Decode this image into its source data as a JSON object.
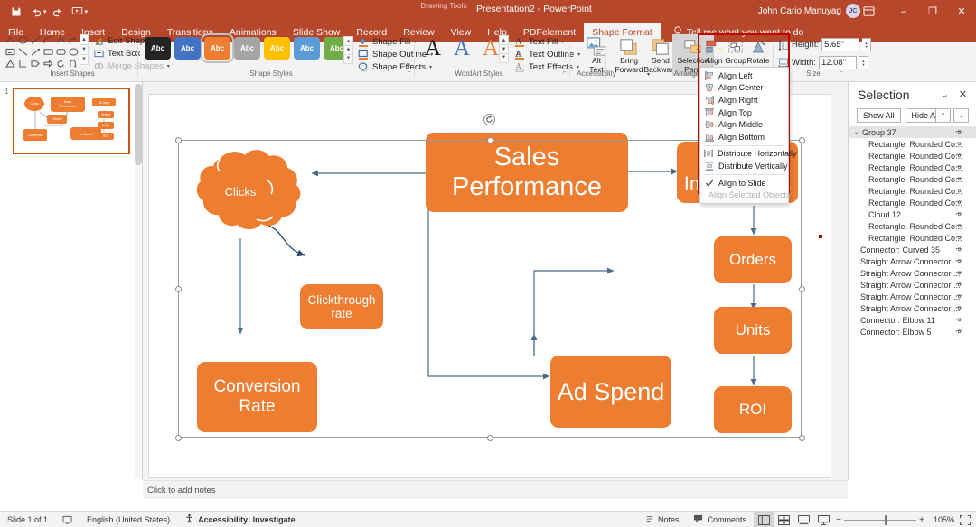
{
  "titlebar": {
    "quick_access": [
      "save-icon",
      "undo-icon",
      "redo-icon",
      "start-presentation-icon",
      "customize-qat-icon"
    ],
    "contextual_tab_group": "Drawing Tools",
    "window_title": "Presentation2  -  PowerPoint",
    "user_name": "John Cario Manuyag",
    "avatar_initials": "JC",
    "ribbon_display_options": "ribbon-display-options-icon",
    "minimize": "–",
    "restore": "❐",
    "close": "✕"
  },
  "tabs": [
    {
      "label": "File",
      "active": false
    },
    {
      "label": "Home",
      "active": false
    },
    {
      "label": "Insert",
      "active": false
    },
    {
      "label": "Design",
      "active": false
    },
    {
      "label": "Transitions",
      "active": false
    },
    {
      "label": "Animations",
      "active": false
    },
    {
      "label": "Slide Show",
      "active": false
    },
    {
      "label": "Record",
      "active": false
    },
    {
      "label": "Review",
      "active": false
    },
    {
      "label": "View",
      "active": false
    },
    {
      "label": "Help",
      "active": false
    },
    {
      "label": "PDFelement",
      "active": false
    },
    {
      "label": "Shape Format",
      "active": true
    }
  ],
  "tell_me": "Tell me what you want to do",
  "ribbon": {
    "groups": [
      {
        "name": "Insert Shapes",
        "label": "Insert Shapes"
      },
      {
        "name": "Shape Styles",
        "label": "Shape Styles"
      },
      {
        "name": "WordArt Styles",
        "label": "WordArt Styles"
      },
      {
        "name": "Accessibility",
        "label": "Accessibility"
      },
      {
        "name": "Arrange",
        "label": "Arrange"
      },
      {
        "name": "Size",
        "label": "Size"
      }
    ],
    "insert_shapes": {
      "commands": [
        {
          "label": "Edit Shape",
          "icon": "edit-shape-icon",
          "has_caret": true,
          "disabled": false
        },
        {
          "label": "Text Box",
          "icon": "text-box-icon",
          "has_caret": false,
          "disabled": false
        },
        {
          "label": "Merge Shapes",
          "icon": "merge-shapes-icon",
          "has_caret": true,
          "disabled": true
        }
      ]
    },
    "shape_styles": {
      "swatch_label": "Abc",
      "swatches": [
        {
          "fill": "#242424",
          "selected": false
        },
        {
          "fill": "#4472c4",
          "selected": false
        },
        {
          "fill": "#ed7d31",
          "selected": true
        },
        {
          "fill": "#a5a5a5",
          "selected": false
        },
        {
          "fill": "#ffc000",
          "selected": false
        },
        {
          "fill": "#5b9bd5",
          "selected": false
        },
        {
          "fill": "#70ad47",
          "selected": false
        }
      ],
      "commands": [
        {
          "label": "Shape Fill",
          "icon": "shape-fill-icon"
        },
        {
          "label": "Shape Outline",
          "icon": "shape-outline-icon"
        },
        {
          "label": "Shape Effects",
          "icon": "shape-effects-icon"
        }
      ]
    },
    "wordart_styles": {
      "letters": [
        "A",
        "A",
        "A"
      ],
      "commands": [
        {
          "label": "Text Fill",
          "icon": "text-fill-icon"
        },
        {
          "label": "Text Outline",
          "icon": "text-outline-icon"
        },
        {
          "label": "Text Effects",
          "icon": "text-effects-icon"
        }
      ]
    },
    "accessibility": {
      "alt_text": "Alt\nText",
      "alt_text_line1": "Alt",
      "alt_text_line2": "Text"
    },
    "arrange": {
      "bring_forward_l1": "Bring",
      "bring_forward_l2": "Forward",
      "send_backward_l1": "Send",
      "send_backward_l2": "Backward",
      "selection_pane_l1": "Selection",
      "selection_pane_l2": "Pane",
      "align": "Align",
      "group": "Group",
      "rotate": "Rotate"
    },
    "size": {
      "height_label": "Height:",
      "height_value": "5.65\"",
      "width_label": "Width:",
      "width_value": "12.08\""
    }
  },
  "align_menu": {
    "items": [
      {
        "label": "Align Left",
        "icon": "align-left-icon",
        "checked": false,
        "disabled": false
      },
      {
        "label": "Align Center",
        "icon": "align-center-icon",
        "checked": false,
        "disabled": false
      },
      {
        "label": "Align Right",
        "icon": "align-right-icon",
        "checked": false,
        "disabled": false
      },
      {
        "label": "Align Top",
        "icon": "align-top-icon",
        "checked": false,
        "disabled": false
      },
      {
        "label": "Align Middle",
        "icon": "align-middle-icon",
        "checked": false,
        "disabled": false
      },
      {
        "label": "Align Bottom",
        "icon": "align-bottom-icon",
        "checked": false,
        "disabled": false
      },
      {
        "label": "Distribute Horizontally",
        "icon": "distribute-horizontally-icon",
        "checked": false,
        "disabled": false
      },
      {
        "label": "Distribute Vertically",
        "icon": "distribute-vertically-icon",
        "checked": false,
        "disabled": false
      },
      {
        "label": "Align to Slide",
        "icon": "checkmark-icon",
        "checked": true,
        "disabled": false
      },
      {
        "label": "Align Selected Objects",
        "icon": "",
        "checked": false,
        "disabled": true
      }
    ]
  },
  "thumbnails": [
    {
      "number": "1",
      "selected": true
    }
  ],
  "slide": {
    "nodes": [
      {
        "id": "clicks",
        "label": "Clicks",
        "shape": "cloud"
      },
      {
        "id": "sales-performance",
        "label": "Sales Performance",
        "shape": "rounded-rect"
      },
      {
        "id": "ad-impressions",
        "label": "Ad Impressions",
        "shape": "rounded-rect"
      },
      {
        "id": "clickthrough-rate",
        "label": "Clickthrough rate",
        "shape": "rounded-rect"
      },
      {
        "id": "conversion-rate",
        "label": "Conversion Rate",
        "shape": "rounded-rect"
      },
      {
        "id": "ad-spend",
        "label": "Ad Spend",
        "shape": "rounded-rect"
      },
      {
        "id": "orders",
        "label": "Orders",
        "shape": "rounded-rect"
      },
      {
        "id": "units",
        "label": "Units",
        "shape": "rounded-rect"
      },
      {
        "id": "roi",
        "label": "ROI",
        "shape": "rounded-rect"
      }
    ],
    "accent_color": "#ed7d31",
    "connector_color": "#4a6b8a"
  },
  "notes_placeholder": "Click to add notes",
  "selection_pane": {
    "title": "Selection",
    "show_all": "Show All",
    "hide_all": "Hide All",
    "collapse_icon": "chevron-down-icon",
    "close_icon": "close-icon",
    "move_up_icon": "chevron-up-icon",
    "move_down_icon": "chevron-down-icon",
    "items": [
      {
        "name": "Group 37",
        "level": 0,
        "group": true,
        "expanded": true
      },
      {
        "name": "Rectangle: Rounded Co...",
        "level": 1,
        "group": false
      },
      {
        "name": "Rectangle: Rounded Co...",
        "level": 1,
        "group": false
      },
      {
        "name": "Rectangle: Rounded Co...",
        "level": 1,
        "group": false
      },
      {
        "name": "Rectangle: Rounded Co...",
        "level": 1,
        "group": false
      },
      {
        "name": "Rectangle: Rounded Co...",
        "level": 1,
        "group": false
      },
      {
        "name": "Rectangle: Rounded Co...",
        "level": 1,
        "group": false
      },
      {
        "name": "Cloud 12",
        "level": 1,
        "group": false
      },
      {
        "name": "Rectangle: Rounded Co...",
        "level": 1,
        "group": false
      },
      {
        "name": "Rectangle: Rounded Co...",
        "level": 1,
        "group": false
      },
      {
        "name": "Connector: Curved 35",
        "level": 0,
        "group": false
      },
      {
        "name": "Straight Arrow Connector ...",
        "level": 0,
        "group": false
      },
      {
        "name": "Straight Arrow Connector ...",
        "level": 0,
        "group": false
      },
      {
        "name": "Straight Arrow Connector ...",
        "level": 0,
        "group": false
      },
      {
        "name": "Straight Arrow Connector ...",
        "level": 0,
        "group": false
      },
      {
        "name": "Straight Arrow Connector ...",
        "level": 0,
        "group": false
      },
      {
        "name": "Connector: Elbow 11",
        "level": 0,
        "group": false
      },
      {
        "name": "Connector: Elbow 5",
        "level": 0,
        "group": false
      }
    ]
  },
  "statusbar": {
    "slide_indicator": "Slide 1 of 1",
    "slide_icon": "slide-icon",
    "language": "English (United States)",
    "accessibility": "Accessibility: Investigate",
    "accessibility_icon": "accessibility-icon",
    "notes": "Notes",
    "comments": "Comments",
    "views": [
      {
        "name": "normal-view",
        "active": true
      },
      {
        "name": "slide-sorter-view",
        "active": false
      },
      {
        "name": "reading-view",
        "active": false
      },
      {
        "name": "slide-show-view",
        "active": false
      }
    ],
    "zoom_out": "−",
    "zoom_in": "+",
    "zoom_level": "105%",
    "fit_to_window": "fit-slide-icon"
  }
}
